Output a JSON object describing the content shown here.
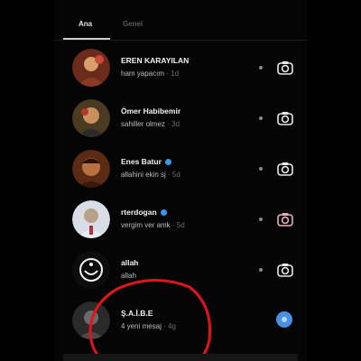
{
  "tabs": {
    "active": "Ana",
    "inactive": "Genel"
  },
  "threads": [
    {
      "name": "EREN KARAYILAN",
      "verified": false,
      "message": "ham yapacım",
      "time": " · 1d",
      "camera_icon": "camera-icon"
    },
    {
      "name": "Ömer Habibemir",
      "verified": false,
      "message": "sahiller olmez",
      "time": " · 3d",
      "camera_icon": "camera-icon"
    },
    {
      "name": "Enes Batur",
      "verified": true,
      "message": "allahini ekin sj",
      "time": " · 5d",
      "camera_icon": "camera-icon"
    },
    {
      "name": "rterdogan",
      "verified": true,
      "message": "vergim ver amk",
      "time": " · 5d",
      "camera_icon": "camera-icon"
    },
    {
      "name": "allah",
      "verified": false,
      "message": "allah",
      "time": "",
      "camera_icon": "camera-icon"
    },
    {
      "name": "Ş.A.İ.B.E",
      "verified": false,
      "message": "4 yeni mesaj",
      "time": " · 4g",
      "camera_icon": "unread-dot"
    }
  ],
  "colors": {
    "accent": "#3897f0",
    "annotation": "#e0141c",
    "background": "#000000"
  }
}
